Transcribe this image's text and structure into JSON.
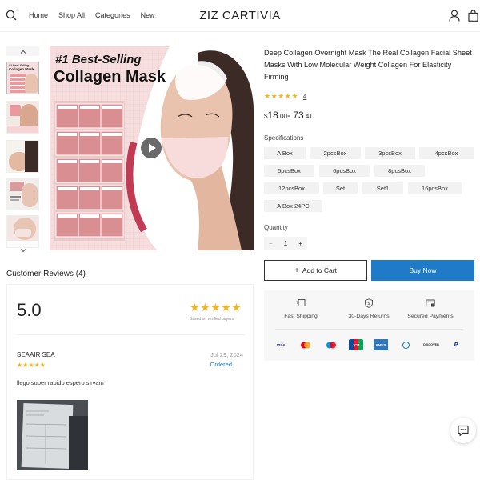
{
  "header": {
    "brand": "ZIZ CARTIVIA",
    "nav": [
      "Home",
      "Shop All",
      "Categories",
      "New"
    ]
  },
  "gallery": {
    "main_line1": "#1 Best-Selling",
    "main_line2": "Collagen Mask",
    "thumb1_line1": "#1 Best-Selling",
    "thumb1_line2": "Collagen Mask"
  },
  "product": {
    "title": "Deep Collagen Overnight Mask The Real Collagen Facial Sheet Masks With Low Molecular Weight Collagen For Elasticity Firming",
    "rating": 5,
    "rating_count": "4",
    "price": {
      "currency": "$",
      "min_whole": "18",
      "min_cents": ".00",
      "separator": "- ",
      "max_whole": "73",
      "max_cents": ".41"
    },
    "specifications_label": "Specifications",
    "options": [
      "A Box",
      "2pcsBox",
      "3pcsBox",
      "4pcsBox",
      "5pcsBox",
      "6pcsBox",
      "8pcsBox",
      "12pcsBox",
      "Set",
      "Set1",
      "16pcsBox",
      "A Box 24PC"
    ],
    "quantity_label": "Quantity",
    "quantity": "1",
    "minus": "−",
    "plus": "+",
    "add_to_cart": "Add to Cart",
    "buy_now": "Buy Now"
  },
  "features": [
    "Fast Shipping",
    "30-Days Returns",
    "Secured Payments"
  ],
  "payments": [
    "VISA",
    "mastercard",
    "maestro",
    "JCB",
    "AMEX",
    "Diners Club",
    "DISCOVER",
    "PayPal"
  ],
  "reviews": {
    "title": "Customer Reviews (4)",
    "score": "5.0",
    "verified_text": "Based on verified buyers",
    "items": [
      {
        "name": "SEAAIR SEA",
        "date": "Jul 29, 2024",
        "status": "Ordered",
        "text": "llego super rapidp espero sirvam"
      }
    ]
  },
  "colors": {
    "accent": "#1f7ac8",
    "star": "#f3b41b",
    "pink": "#e89a9e"
  }
}
